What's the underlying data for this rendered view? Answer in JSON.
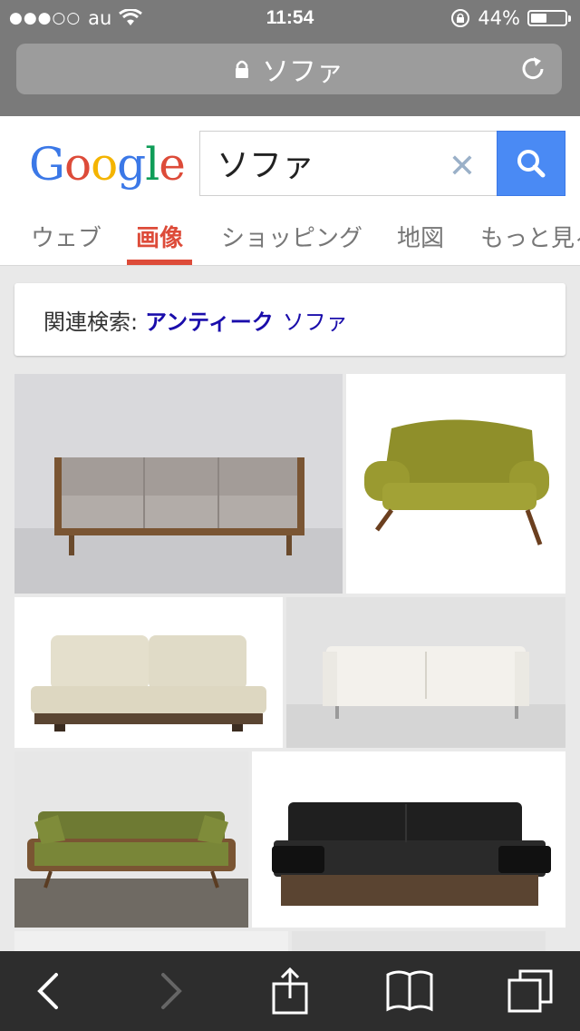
{
  "status": {
    "carrier": "au",
    "signal_dots": "●●●○○",
    "time": "11:54",
    "battery": "44%",
    "battery_level": 0.44
  },
  "urlbar": {
    "text": "ソファ"
  },
  "google": {
    "logo": "Google",
    "search_value": "ソファ"
  },
  "tabs": [
    {
      "label": "ウェブ"
    },
    {
      "label": "画像"
    },
    {
      "label": "ショッピング"
    },
    {
      "label": "地図"
    },
    {
      "label": "もっと見る"
    }
  ],
  "related": {
    "prefix": "関連検索:",
    "bold": "アンティーク",
    "normal": "ソファ"
  },
  "colors": {
    "accent_red": "#dd4b39",
    "link_blue": "#1a0dab",
    "search_blue": "#4a8af4"
  },
  "icons": [
    "wifi-icon",
    "rotation-lock-icon",
    "lock-icon",
    "reload-icon",
    "clear-icon",
    "search-icon",
    "back-icon",
    "forward-icon",
    "share-icon",
    "bookmarks-icon",
    "tabs-icon"
  ]
}
